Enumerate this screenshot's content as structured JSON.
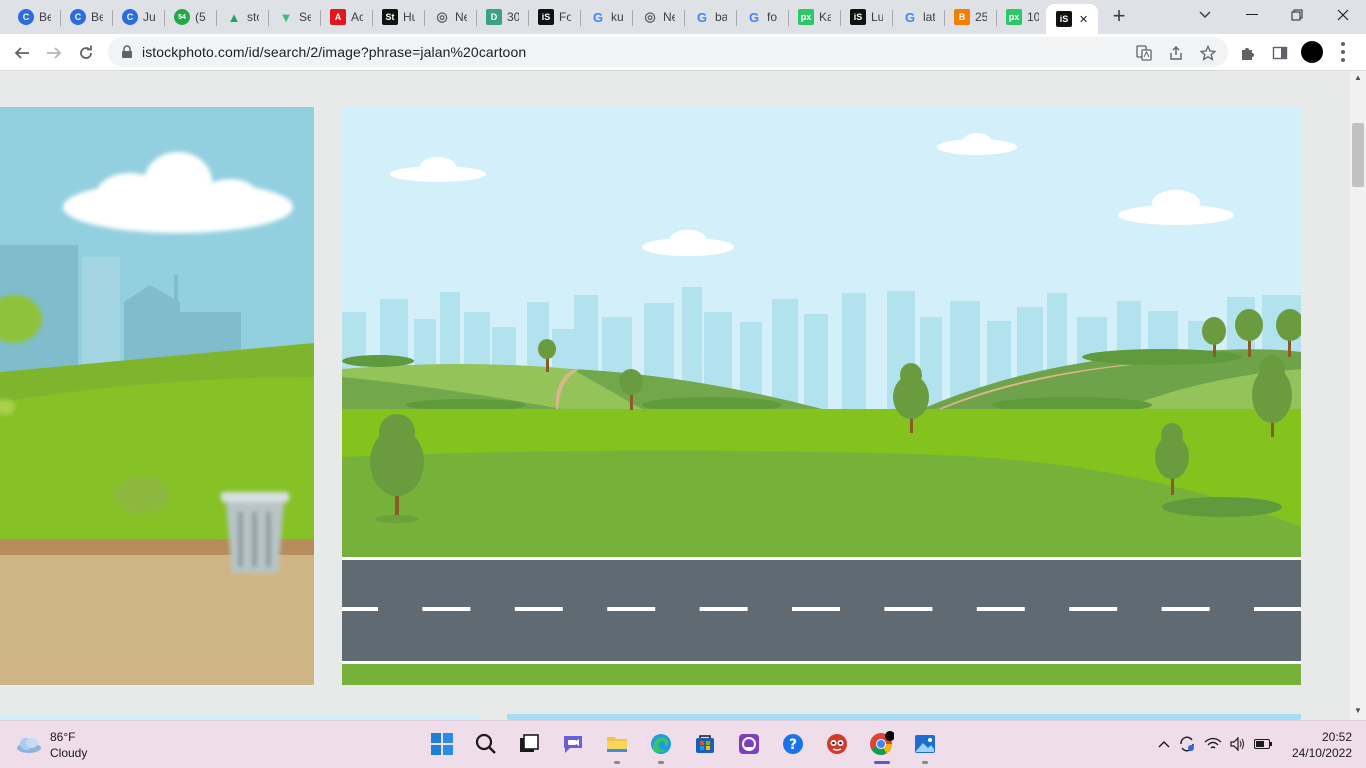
{
  "browser": {
    "tabs": [
      {
        "title": "Be",
        "favicon": "canva-icon",
        "color": "#2b6ce0",
        "glyph": "C"
      },
      {
        "title": "Be",
        "favicon": "canva-icon",
        "color": "#2b6ce0",
        "glyph": "C"
      },
      {
        "title": "Ju",
        "favicon": "canva-icon",
        "color": "#2b6ce0",
        "glyph": "C"
      },
      {
        "title": "(5",
        "favicon": "whatsapp-icon",
        "color": "#25a84a",
        "glyph": "54"
      },
      {
        "title": "sto",
        "favicon": "google-drive-icon",
        "color": "#1fa463",
        "glyph": "▲"
      },
      {
        "title": "Se",
        "favicon": "vue-icon",
        "color": "#41b883",
        "glyph": "▼"
      },
      {
        "title": "Ac",
        "favicon": "adobe-icon",
        "color": "#e3161e",
        "glyph": "A"
      },
      {
        "title": "Hu",
        "favicon": "shutterstock-icon",
        "color": "#111111",
        "glyph": "St"
      },
      {
        "title": "Ne",
        "favicon": "chrome-icon",
        "color": "#5f6368",
        "glyph": "◎"
      },
      {
        "title": "30",
        "favicon": "dafont-icon",
        "color": "#3aa08a",
        "glyph": "D"
      },
      {
        "title": "Fo",
        "favicon": "istock-icon",
        "color": "#111111",
        "glyph": "iS"
      },
      {
        "title": "ku",
        "favicon": "google-icon",
        "color": "#4285f4",
        "glyph": "G"
      },
      {
        "title": "Ne",
        "favicon": "chrome-icon",
        "color": "#5f6368",
        "glyph": "◎"
      },
      {
        "title": "ba",
        "favicon": "google-icon",
        "color": "#4285f4",
        "glyph": "G"
      },
      {
        "title": "fo",
        "favicon": "google-icon",
        "color": "#4285f4",
        "glyph": "G"
      },
      {
        "title": "Ka",
        "favicon": "pixabay-icon",
        "color": "#2ec66d",
        "glyph": "px"
      },
      {
        "title": "Lu",
        "favicon": "istock-icon",
        "color": "#111111",
        "glyph": "iS"
      },
      {
        "title": "lat",
        "favicon": "google-icon",
        "color": "#4285f4",
        "glyph": "G"
      },
      {
        "title": "25",
        "favicon": "blogger-icon",
        "color": "#f57d00",
        "glyph": "B"
      },
      {
        "title": "10",
        "favicon": "pixabay-icon",
        "color": "#2ec66d",
        "glyph": "px"
      },
      {
        "title": "",
        "favicon": "istock-icon",
        "color": "#111111",
        "glyph": "iS",
        "active": true
      }
    ],
    "new_tab_label": "+",
    "url": "istockphoto.com/id/search/2/image?phrase=jalan%20cartoon"
  },
  "colors": {
    "sky": "#d3f0fa",
    "city": "#b5e3ef",
    "grass_light": "#84c21d",
    "grass_dark": "#76b23a",
    "hill": "#73a74b",
    "road": "#5f6a73",
    "road_line": "#ffffff",
    "tree": "#6a9c3f",
    "trunk": "#8a5a2b",
    "path": "#d8b78a"
  },
  "taskbar": {
    "weather": {
      "temp": "86°F",
      "condition": "Cloudy"
    },
    "clock": {
      "time": "20:52",
      "date": "24/10/2022"
    },
    "apps": [
      {
        "name": "start-icon"
      },
      {
        "name": "search-icon"
      },
      {
        "name": "task-view-icon"
      },
      {
        "name": "teams-chat-icon"
      },
      {
        "name": "file-explorer-icon"
      },
      {
        "name": "edge-icon"
      },
      {
        "name": "microsoft-store-icon"
      },
      {
        "name": "app-icon"
      },
      {
        "name": "help-icon"
      },
      {
        "name": "game-icon"
      },
      {
        "name": "chrome-icon",
        "active": true
      },
      {
        "name": "photos-icon"
      }
    ]
  }
}
